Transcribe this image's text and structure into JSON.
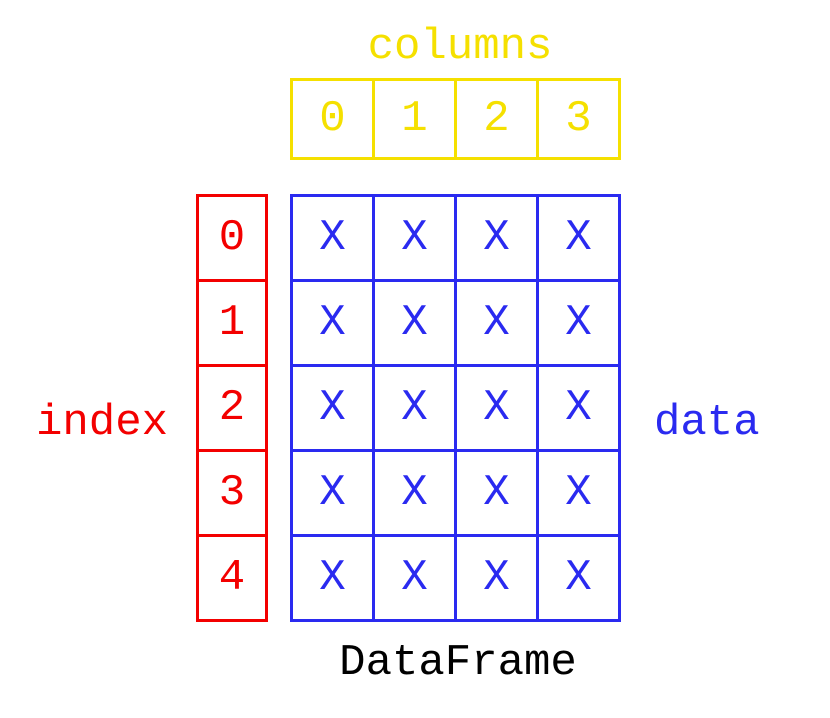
{
  "columns_title": "columns",
  "index_label": "index",
  "data_label": "data",
  "title": "DataFrame",
  "columns": [
    "0",
    "1",
    "2",
    "3"
  ],
  "index": [
    "0",
    "1",
    "2",
    "3",
    "4"
  ],
  "data": [
    [
      "X",
      "X",
      "X",
      "X"
    ],
    [
      "X",
      "X",
      "X",
      "X"
    ],
    [
      "X",
      "X",
      "X",
      "X"
    ],
    [
      "X",
      "X",
      "X",
      "X"
    ],
    [
      "X",
      "X",
      "X",
      "X"
    ]
  ],
  "colors": {
    "columns": "#f5e000",
    "index": "#f30000",
    "data": "#2a2af0",
    "title": "#000000"
  }
}
